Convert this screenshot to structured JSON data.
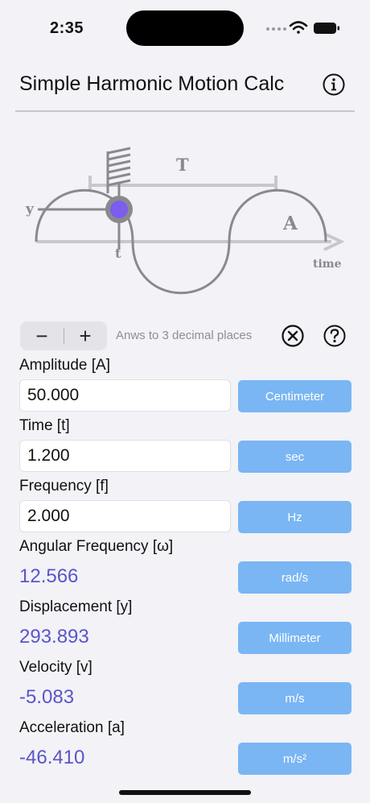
{
  "status_bar": {
    "time": "2:35"
  },
  "header": {
    "title": "Simple Harmonic Motion Calc",
    "info_icon": "info-icon"
  },
  "diagram": {
    "label_T": "T",
    "label_y": "y",
    "label_t": "t",
    "label_A": "A",
    "label_time": "time",
    "mass_color": "#7d5cf0"
  },
  "controls": {
    "minus": "−",
    "plus": "+",
    "decimals_text": "Anws to 3 decimal places"
  },
  "fields": {
    "amplitude": {
      "label": "Amplitude [A]",
      "value": "50.000",
      "unit": "Centimeter"
    },
    "time": {
      "label": "Time [t]",
      "value": "1.200",
      "unit": "sec"
    },
    "frequency": {
      "label": "Frequency [f]",
      "value": "2.000",
      "unit": "Hz"
    }
  },
  "results": {
    "angular_frequency": {
      "label": "Angular Frequency [ω]",
      "value": "12.566",
      "unit": "rad/s"
    },
    "displacement": {
      "label": "Displacement [y]",
      "value": "293.893",
      "unit": "Millimeter"
    },
    "velocity": {
      "label": "Velocity [v]",
      "value": "-5.083",
      "unit": "m/s"
    },
    "acceleration": {
      "label": "Acceleration [a]",
      "value": "-46.410",
      "unit": "m/s²"
    }
  },
  "colors": {
    "accent_button": "#7ab6f3",
    "result_text": "#5a55c9",
    "background": "#f2f2f7"
  }
}
